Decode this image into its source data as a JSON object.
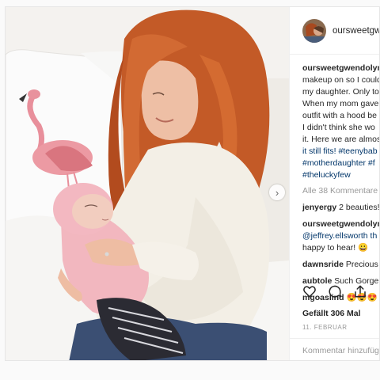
{
  "post": {
    "username": "oursweetgwendolyn",
    "caption_lines": [
      "makeup on so I could",
      "my daughter. Only to",
      "When my mom gave",
      "outfit with a hood be",
      "I didn't think she wo",
      "it. Here we are almos",
      "it still fits! #teenybab",
      "#motherdaughter #f",
      "#theluckyfew"
    ],
    "caption_author": "oursweetgwendolyn",
    "view_all": "Alle 38 Kommentare",
    "comments": [
      {
        "user": "jenyergy",
        "text": "2 beauties!"
      },
      {
        "user": "oursweetgwendolyn",
        "text": "",
        "extra_lines": [
          "@jeffrey.ellsworth th",
          "happy to hear! 😀"
        ]
      },
      {
        "user": "dawnsride",
        "text": "Precious"
      },
      {
        "user": "aubtole",
        "text": "Such Gorge"
      },
      {
        "user": "mgoaslind",
        "text": "😍😍😍"
      }
    ],
    "likes": "Gefällt 306 Mal",
    "date": "11. FEBRUAR",
    "add_comment_placeholder": "Kommentar hinzufüg",
    "next_arrow": "›"
  },
  "icons": {
    "like": "heart-icon",
    "comment": "comment-icon",
    "share": "share-icon",
    "next": "chevron-right-icon"
  },
  "colors": {
    "text": "#262626",
    "muted": "#999999",
    "hashtag": "#003569",
    "border": "#efefef"
  }
}
